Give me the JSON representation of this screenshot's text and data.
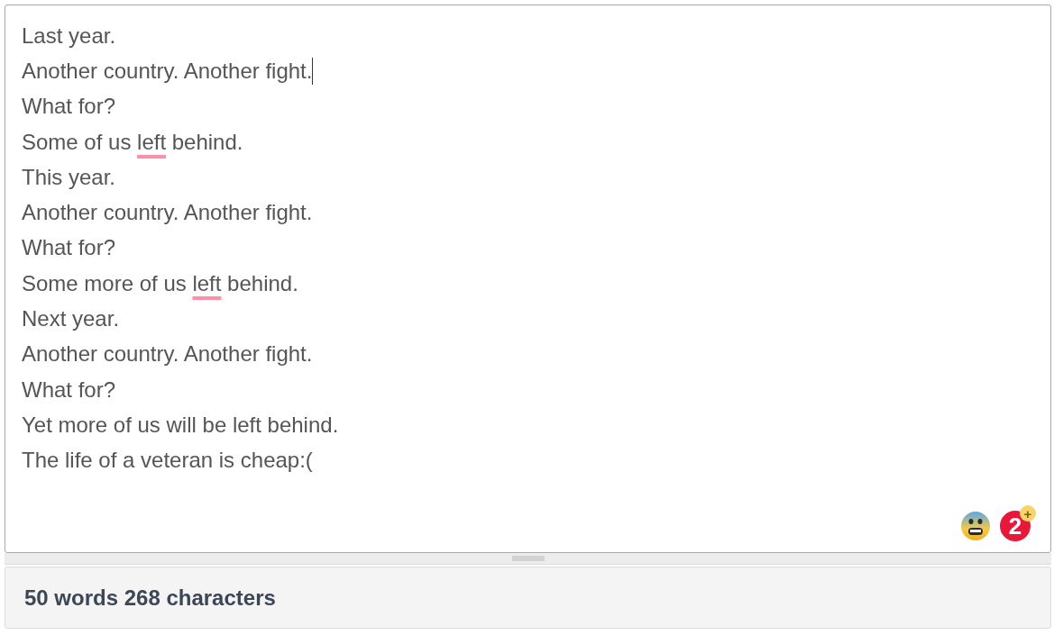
{
  "editor": {
    "lines": [
      {
        "segments": [
          {
            "text": "Last year.",
            "flagged": false
          }
        ],
        "caret": false
      },
      {
        "segments": [
          {
            "text": "Another country. Another fight.",
            "flagged": false
          }
        ],
        "caret": true
      },
      {
        "segments": [
          {
            "text": "What for?",
            "flagged": false
          }
        ],
        "caret": false
      },
      {
        "segments": [
          {
            "text": "Some of us ",
            "flagged": false
          },
          {
            "text": "left",
            "flagged": true
          },
          {
            "text": " behind.",
            "flagged": false
          }
        ],
        "caret": false
      },
      {
        "segments": [
          {
            "text": "This year.",
            "flagged": false
          }
        ],
        "caret": false
      },
      {
        "segments": [
          {
            "text": "Another country. Another fight.",
            "flagged": false
          }
        ],
        "caret": false
      },
      {
        "segments": [
          {
            "text": "What for?",
            "flagged": false
          }
        ],
        "caret": false
      },
      {
        "segments": [
          {
            "text": "Some more of us ",
            "flagged": false
          },
          {
            "text": "left",
            "flagged": true
          },
          {
            "text": " behind.",
            "flagged": false
          }
        ],
        "caret": false
      },
      {
        "segments": [
          {
            "text": "Next year.",
            "flagged": false
          }
        ],
        "caret": false
      },
      {
        "segments": [
          {
            "text": "Another country. Another fight.",
            "flagged": false
          }
        ],
        "caret": false
      },
      {
        "segments": [
          {
            "text": "What for?",
            "flagged": false
          }
        ],
        "caret": false
      },
      {
        "segments": [
          {
            "text": "Yet more of us will be left behind.",
            "flagged": false
          }
        ],
        "caret": false
      },
      {
        "segments": [
          {
            "text": "The life of a veteran is cheap:(",
            "flagged": false
          }
        ],
        "caret": false
      }
    ],
    "badge": {
      "count": "2",
      "plus": "+"
    }
  },
  "status_bar": {
    "text": "50 words 268 characters"
  }
}
